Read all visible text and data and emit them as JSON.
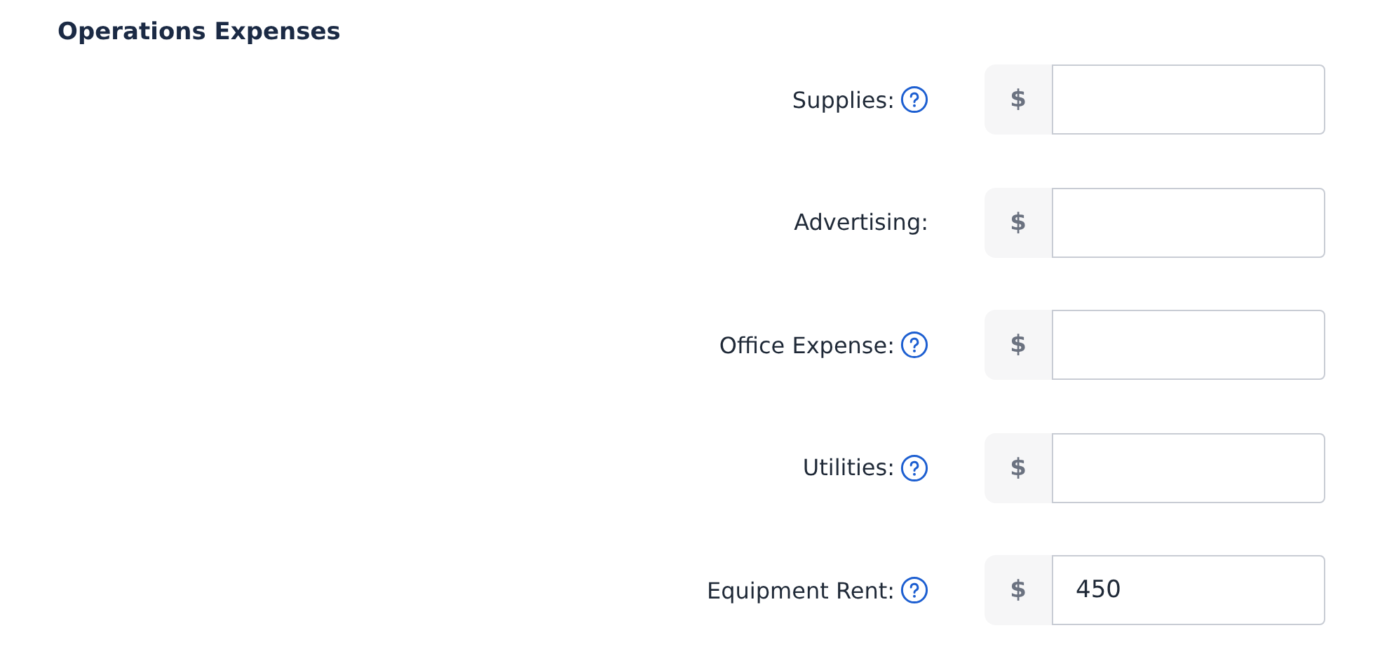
{
  "section": {
    "title": "Operations Expenses"
  },
  "fields": [
    {
      "label": "Supplies:",
      "help": true,
      "prefix": "$"
    },
    {
      "label": "Advertising:",
      "help": false,
      "prefix": "$"
    },
    {
      "label": "Office Expense:",
      "help": true,
      "prefix": "$"
    },
    {
      "label": "Utilities:",
      "help": true,
      "prefix": "$"
    },
    {
      "label": "Equipment Rent:",
      "help": true,
      "prefix": "$",
      "value": "450"
    }
  ]
}
